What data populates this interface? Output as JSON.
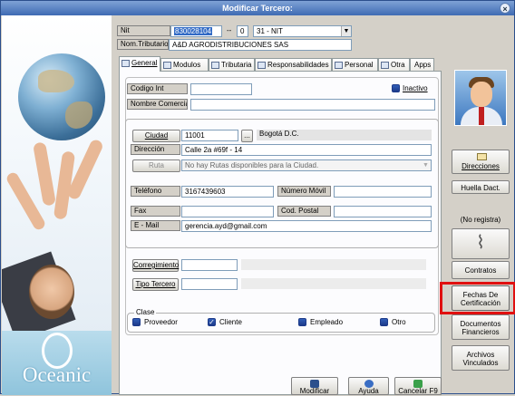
{
  "window": {
    "title": "Modificar Tercero:",
    "close_glyph": "×"
  },
  "branding": {
    "logo_text": "Oceanic"
  },
  "header": {
    "nit_label": "Nit",
    "nit_value": "830028104",
    "dash": "--",
    "check_digit": "0",
    "doc_type": "31 - NIT",
    "nom_trib_label": "Nom.Tributario",
    "nom_trib_value": "A&D AGRODISTRIBUCIONES SAS"
  },
  "tabs": [
    {
      "label": "General"
    },
    {
      "label": "Modulos"
    },
    {
      "label": "Tributaria"
    },
    {
      "label": "Responsabilidades"
    },
    {
      "label": "Personal"
    },
    {
      "label": "Otra"
    },
    {
      "label": "Apps"
    }
  ],
  "general": {
    "codigo_int_label": "Codigo Int",
    "codigo_int_value": "",
    "inactivo_label": "Inactivo",
    "nombre_comercial_label": "Nombre Comercial",
    "nombre_comercial_value": "",
    "ciudad_button": "Ciudad",
    "ciudad_code": "11001",
    "ciudad_lookup": "...",
    "ciudad_name": "Bogotá D.C.",
    "direccion_label": "Dirección",
    "direccion_value": "Calle 2a #69f - 14",
    "ruta_button": "Ruta",
    "ruta_value": "No hay Rutas disponibles para la Ciudad.",
    "telefono_label": "Teléfono",
    "telefono_value": "3167439603",
    "movil_label": "Número Móvil",
    "movil_value": "",
    "fax_label": "Fax",
    "fax_value": "",
    "postal_label": "Cod. Postal",
    "postal_value": "",
    "email_label": "E - Mail",
    "email_value": "gerencia.ayd@gmail.com",
    "corregimiento_button": "Corregimiento",
    "corregimiento_value": "",
    "tipo_tercero_button": "Tipo Tercero",
    "tipo_tercero_value": "",
    "clase_label": "Clase",
    "clase_options": [
      "Proveedor",
      "Cliente",
      "Empleado",
      "Otro"
    ]
  },
  "right": {
    "direcciones": "Direcciones",
    "huella": "Huella Dact.",
    "no_registra": "(No registra)",
    "contratos": "Contratos",
    "fechas_1": "Fechas De",
    "fechas_2": "Certificación",
    "documentos_1": "Documentos",
    "documentos_2": "Financieros",
    "archivos_1": "Archivos",
    "archivos_2": "Vinculados"
  },
  "footer": {
    "modificar": "Modificar",
    "ayuda": "Ayuda",
    "cancelar": "Cancelar F9"
  },
  "colors": {
    "highlight": "#e01010",
    "selection": "#316ac5",
    "titlebar": "#3f6bb3"
  }
}
